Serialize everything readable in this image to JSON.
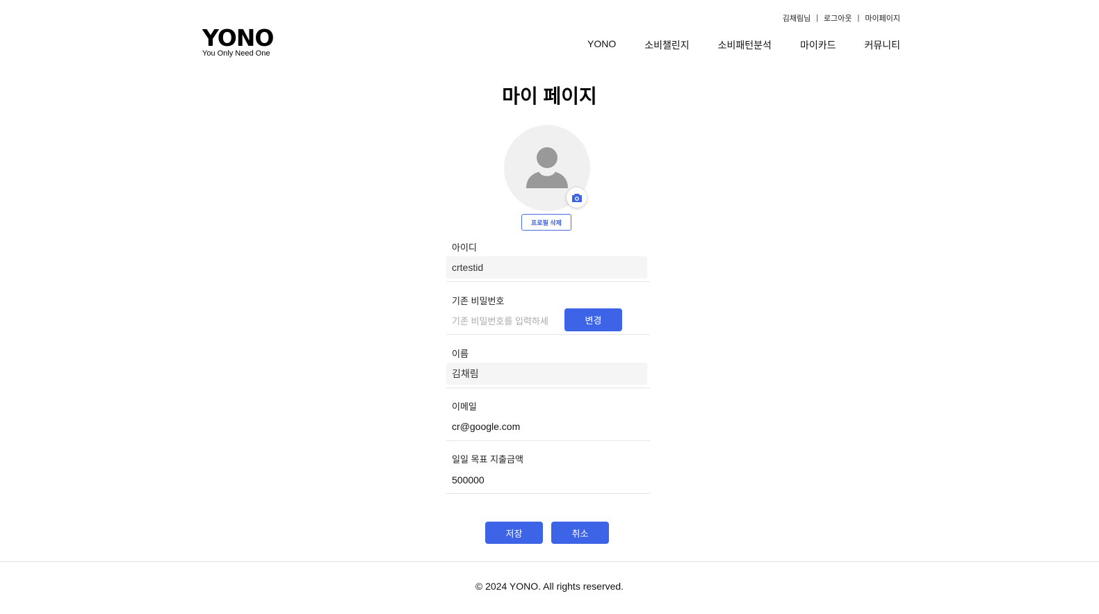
{
  "util_nav": {
    "user_greeting": "김채림님",
    "logout": "로그아웃",
    "mypage": "마이페이지",
    "separator": "|"
  },
  "logo": {
    "title": "YONO",
    "subtitle": "You Only Need One"
  },
  "main_nav": [
    "YONO",
    "소비챌린지",
    "소비패턴분석",
    "마이카드",
    "커뮤니티"
  ],
  "page_title": "마이 페이지",
  "profile": {
    "avatar_icon": "person-icon",
    "camera_icon": "camera-icon",
    "delete_button": "프로필 삭제"
  },
  "fields": {
    "id": {
      "label": "아이디",
      "value": "crtestid"
    },
    "password": {
      "label": "기존 비밀번호",
      "placeholder": "기존 비밀번호를 입력하세",
      "button": "변경"
    },
    "name": {
      "label": "이름",
      "value": "김채림"
    },
    "email": {
      "label": "이메일",
      "value": "cr@google.com"
    },
    "daily_goal": {
      "label": "일일 목표 지출금액",
      "value": "500000"
    }
  },
  "actions": {
    "save": "저장",
    "cancel": "취소"
  },
  "footer": "© 2024 YONO. All rights reserved.",
  "colors": {
    "accent": "#3d63e6",
    "field_bg": "#f5f5f5",
    "avatar_bg": "#f0f0f0"
  }
}
